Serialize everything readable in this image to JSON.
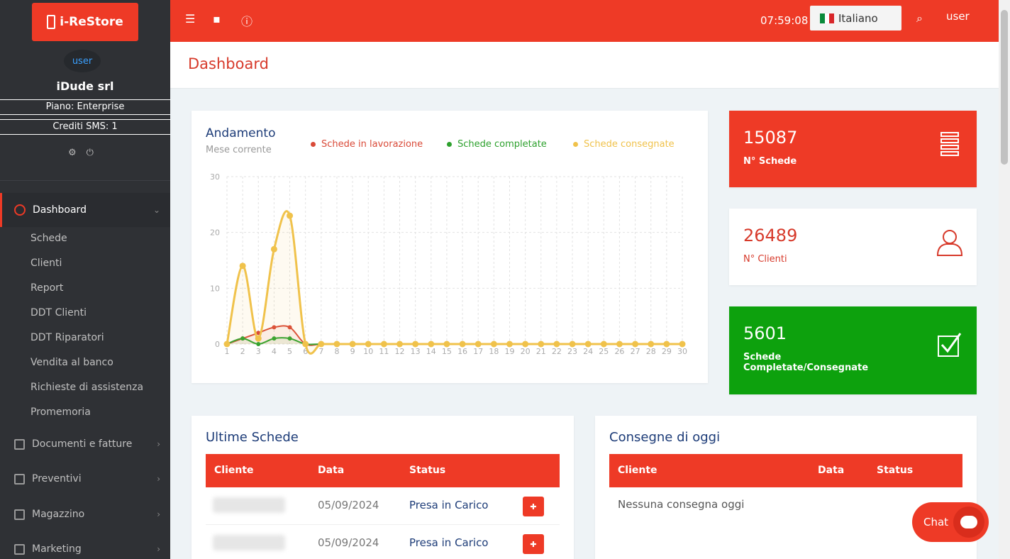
{
  "brand": {
    "name": "i-ReStore"
  },
  "sidebar": {
    "avatar_alt": "user",
    "company": "iDude srl",
    "plan": "Piano: Enterprise",
    "sms": "Crediti SMS: 1",
    "active": {
      "label": "Dashboard",
      "icon": "dashboard-icon"
    },
    "sub_items": [
      "Schede",
      "Clienti",
      "Report",
      "DDT Clienti",
      "DDT Riparatori",
      "Vendita al banco",
      "Richieste di assistenza",
      "Promemoria"
    ],
    "sections": [
      {
        "label": "Documenti e fatture",
        "icon": "document-icon"
      },
      {
        "label": "Preventivi",
        "icon": "clipboard-icon"
      },
      {
        "label": "Magazzino",
        "icon": "box-icon"
      },
      {
        "label": "Marketing",
        "icon": "newspaper-icon"
      }
    ]
  },
  "topbar": {
    "time": "07:59:08",
    "language": "Italiano",
    "user": "user"
  },
  "page": {
    "title": "Dashboard"
  },
  "chart": {
    "title": "Andamento",
    "subtitle": "Mese corrente",
    "legend": [
      {
        "label": "Schede in lavorazione",
        "color": "#d94a38"
      },
      {
        "label": "Schede completate",
        "color": "#2ea12e"
      },
      {
        "label": "Schede consegnate",
        "color": "#f0c24b"
      }
    ]
  },
  "chart_data": {
    "type": "area",
    "x": [
      1,
      2,
      3,
      4,
      5,
      6,
      7,
      8,
      9,
      10,
      11,
      12,
      13,
      14,
      15,
      16,
      17,
      18,
      19,
      20,
      21,
      22,
      23,
      24,
      25,
      26,
      27,
      28,
      29,
      30
    ],
    "ylim": [
      0,
      30
    ],
    "yticks": [
      0,
      10,
      20,
      30
    ],
    "series": [
      {
        "name": "Schede in lavorazione",
        "values": [
          0,
          1,
          2,
          3,
          3,
          0,
          0,
          0,
          0,
          0,
          0,
          0,
          0,
          0,
          0,
          0,
          0,
          0,
          0,
          0,
          0,
          0,
          0,
          0,
          0,
          0,
          0,
          0,
          0,
          0
        ]
      },
      {
        "name": "Schede completate",
        "values": [
          0,
          1,
          0,
          1,
          1,
          0,
          0,
          0,
          0,
          0,
          0,
          0,
          0,
          0,
          0,
          0,
          0,
          0,
          0,
          0,
          0,
          0,
          0,
          0,
          0,
          0,
          0,
          0,
          0,
          0
        ]
      },
      {
        "name": "Schede consegnate",
        "values": [
          0,
          14,
          1,
          17,
          23,
          0,
          0,
          0,
          0,
          0,
          0,
          0,
          0,
          0,
          0,
          0,
          0,
          0,
          0,
          0,
          0,
          0,
          0,
          0,
          0,
          0,
          0,
          0,
          0,
          0
        ]
      }
    ]
  },
  "stats": [
    {
      "value": "15087",
      "label": "N° Schede",
      "icon": "list-icon"
    },
    {
      "value": "26489",
      "label": "N° Clienti",
      "icon": "user-icon"
    },
    {
      "value": "5601",
      "label": "Schede Completate/Consegnate",
      "icon": "checkbox-icon"
    }
  ],
  "latest": {
    "title": "Ultime Schede",
    "columns": [
      "Cliente",
      "Data",
      "Status"
    ],
    "rows": [
      {
        "date": "05/09/2024",
        "status": "Presa in Carico"
      },
      {
        "date": "05/09/2024",
        "status": "Presa in Carico"
      }
    ]
  },
  "deliveries": {
    "title": "Consegne di oggi",
    "columns": [
      "Cliente",
      "Data",
      "Status"
    ],
    "empty": "Nessuna consegna oggi"
  },
  "chat": {
    "label": "Chat"
  }
}
